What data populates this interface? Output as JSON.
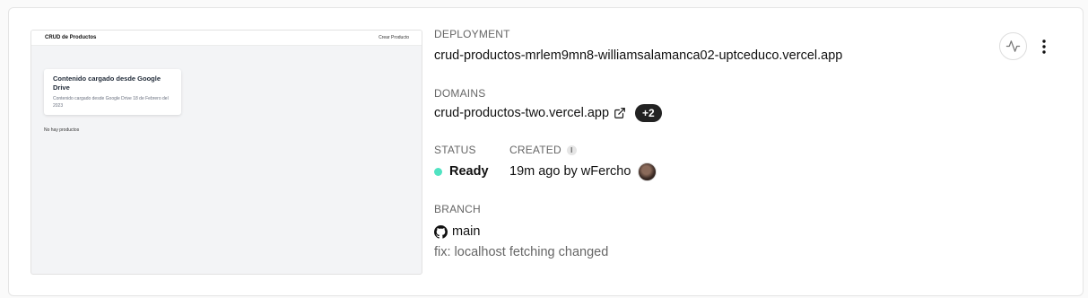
{
  "preview": {
    "brand": "CRUD de Productos",
    "nav_link": "Crear Producto",
    "card_title": "Contenido cargado desde Google Drive",
    "card_desc": "Contenido cargado desde Google Drive 18 de Febrero del 2023",
    "empty_text": "No hay productos"
  },
  "deployment": {
    "label": "DEPLOYMENT",
    "url": "crud-productos-mrlem9mn8-williamsalamanca02-uptceduco.vercel.app"
  },
  "domains": {
    "label": "DOMAINS",
    "primary": "crud-productos-two.vercel.app",
    "extra_count": "+2"
  },
  "status": {
    "label": "STATUS",
    "value": "Ready",
    "color": "#50e3c2"
  },
  "created": {
    "label": "CREATED",
    "value": "19m ago by wFercho"
  },
  "branch": {
    "label": "BRANCH",
    "name": "main",
    "commit_message": "fix: localhost fetching changed"
  },
  "icons": {
    "external": "external-link-icon",
    "info": "info-icon",
    "github": "github-icon",
    "activity": "activity-icon",
    "more": "more-vertical-icon"
  }
}
